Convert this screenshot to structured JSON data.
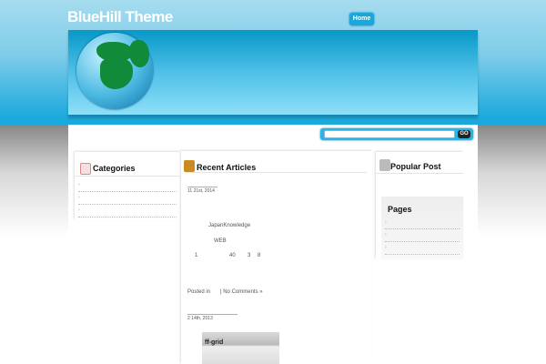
{
  "header": {
    "site_title": "BlueHill Theme",
    "nav": [
      {
        "label": "Home"
      }
    ]
  },
  "search": {
    "value": "",
    "button": "GO"
  },
  "sidebar_left": {
    "title": "Categories",
    "items": [
      "›",
      "›",
      "›"
    ]
  },
  "main": {
    "title": "Recent Articles",
    "posts": [
      {
        "date": "11  21st, 2014",
        "lines": [
          "JapanKnowledge",
          "WEB",
          "1",
          "40",
          "3",
          "8"
        ],
        "posted_in": "Posted in",
        "comments": "| No Comments »"
      },
      {
        "date": "2  14th, 2013",
        "thumbnail_text": "ff-grid"
      }
    ]
  },
  "sidebar_right": {
    "popular_title": "Popular Post",
    "pages_title": "Pages",
    "pages_items": [
      "›",
      "›",
      "›"
    ]
  }
}
